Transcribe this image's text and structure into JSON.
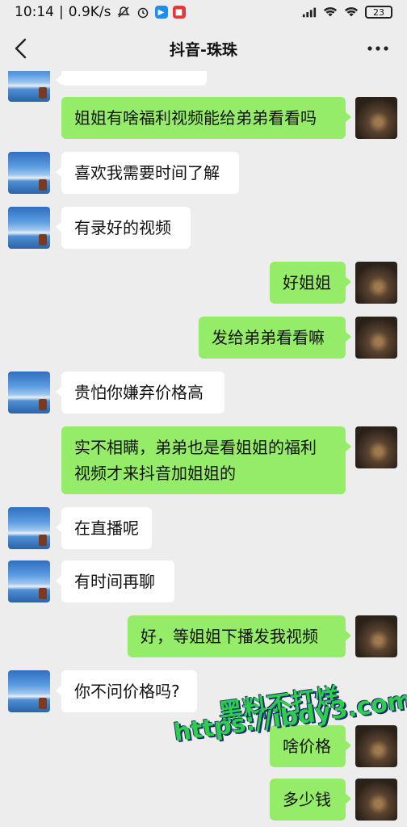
{
  "status": {
    "time": "10:14",
    "speed": "0.9K/s",
    "battery": "23"
  },
  "header": {
    "title": "抖音-珠珠"
  },
  "messages": [
    {
      "side": "left",
      "text": ""
    },
    {
      "side": "right",
      "text": "姐姐有啥福利视频能给弟弟看看吗"
    },
    {
      "side": "left",
      "text": "喜欢我需要时间了解"
    },
    {
      "side": "left",
      "text": "有录好的视频"
    },
    {
      "side": "right",
      "text": "好姐姐"
    },
    {
      "side": "right",
      "text": "发给弟弟看看嘛"
    },
    {
      "side": "left",
      "text": "贵怕你嫌弃价格高"
    },
    {
      "side": "right",
      "text": "实不相瞒，弟弟也是看姐姐的福利\n视频才来抖音加姐姐的"
    },
    {
      "side": "left",
      "text": "在直播呢"
    },
    {
      "side": "left",
      "text": "有时间再聊"
    },
    {
      "side": "right",
      "text": "好，等姐姐下播发我视频"
    },
    {
      "side": "left",
      "text": "你不问价格吗?"
    },
    {
      "side": "right",
      "text": "啥价格"
    },
    {
      "side": "right",
      "text": "多少钱"
    }
  ],
  "watermark": {
    "line1": "黑料不打烊",
    "line2": "https://ibdy3.com"
  }
}
